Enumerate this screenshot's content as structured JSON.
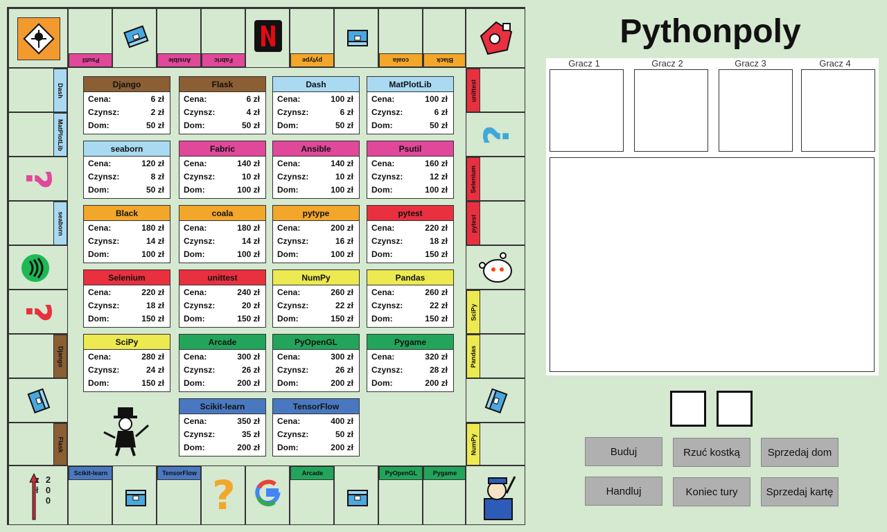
{
  "app": {
    "title": "Pythonpoly"
  },
  "players": [
    {
      "label": "Gracz 1"
    },
    {
      "label": "Gracz 2"
    },
    {
      "label": "Gracz 3"
    },
    {
      "label": "Gracz 4"
    }
  ],
  "buttons": {
    "build": "Buduj",
    "roll": "Rzuć kostką",
    "sell_house": "Sprzedaj dom",
    "trade": "Handluj",
    "end_turn": "Koniec tury",
    "sell_card": "Sprzedaj kartę"
  },
  "start": {
    "amount": "200 zł"
  },
  "board": {
    "top": [
      "Psutil",
      "Ansible",
      "Fabric",
      "pytype",
      "coala",
      "Black"
    ],
    "right": [
      "unittest",
      "Selenium",
      "pytest",
      "SciPy",
      "Pandas",
      "NumPy"
    ],
    "bottom": [
      "Scikit-learn",
      "TensorFlow",
      "Arcade",
      "PyOpenGL",
      "Pygame"
    ],
    "left": [
      "Dash",
      "MatPlotLib",
      "seaborn",
      "Django",
      "Flask"
    ]
  },
  "colors": {
    "brown": "#8b5e34",
    "lightblue": "#a9daf2",
    "pink": "#e0489a",
    "orange": "#f2a72a",
    "red": "#e8303f",
    "yellow": "#ecea50",
    "green": "#22a55a",
    "blue": "#4a78c0"
  },
  "labels": {
    "price": "Cena:",
    "rent": "Czynsz:",
    "house": "Dom:"
  },
  "cards": [
    {
      "name": "Django",
      "color": "#8b5e34",
      "price": "6 zł",
      "rent": "2 zł",
      "house": "50 zł"
    },
    {
      "name": "Flask",
      "color": "#8b5e34",
      "price": "6 zł",
      "rent": "4 zł",
      "house": "50 zł"
    },
    {
      "name": "Dash",
      "color": "#a9daf2",
      "price": "100 zł",
      "rent": "6 zł",
      "house": "50 zł"
    },
    {
      "name": "MatPlotLib",
      "color": "#a9daf2",
      "price": "100 zł",
      "rent": "6 zł",
      "house": "50 zł"
    },
    {
      "name": "seaborn",
      "color": "#a9daf2",
      "price": "120 zł",
      "rent": "8 zł",
      "house": "50 zł"
    },
    {
      "name": "Fabric",
      "color": "#e0489a",
      "price": "140 zł",
      "rent": "10 zł",
      "house": "100 zł"
    },
    {
      "name": "Ansible",
      "color": "#e0489a",
      "price": "140 zł",
      "rent": "10 zł",
      "house": "100 zł"
    },
    {
      "name": "Psutil",
      "color": "#e0489a",
      "price": "160 zł",
      "rent": "12 zł",
      "house": "100 zł"
    },
    {
      "name": "Black",
      "color": "#f2a72a",
      "price": "180 zł",
      "rent": "14 zł",
      "house": "100 zł"
    },
    {
      "name": "coala",
      "color": "#f2a72a",
      "price": "180 zł",
      "rent": "14 zł",
      "house": "100 zł"
    },
    {
      "name": "pytype",
      "color": "#f2a72a",
      "price": "200 zł",
      "rent": "16 zł",
      "house": "100 zł"
    },
    {
      "name": "pytest",
      "color": "#e8303f",
      "price": "220 zł",
      "rent": "18 zł",
      "house": "150 zł"
    },
    {
      "name": "Selenium",
      "color": "#e8303f",
      "price": "220 zł",
      "rent": "18 zł",
      "house": "150 zł"
    },
    {
      "name": "unittest",
      "color": "#e8303f",
      "price": "240 zł",
      "rent": "20 zł",
      "house": "150 zł"
    },
    {
      "name": "NumPy",
      "color": "#ecea50",
      "price": "260 zł",
      "rent": "22 zł",
      "house": "150 zł"
    },
    {
      "name": "Pandas",
      "color": "#ecea50",
      "price": "260 zł",
      "rent": "22 zł",
      "house": "150 zł"
    },
    {
      "name": "SciPy",
      "color": "#ecea50",
      "price": "280 zł",
      "rent": "24 zł",
      "house": "150 zł"
    },
    {
      "name": "Arcade",
      "color": "#22a55a",
      "price": "300 zł",
      "rent": "26 zł",
      "house": "200 zł"
    },
    {
      "name": "PyOpenGL",
      "color": "#22a55a",
      "price": "300 zł",
      "rent": "26 zł",
      "house": "200 zł"
    },
    {
      "name": "Pygame",
      "color": "#22a55a",
      "price": "320 zł",
      "rent": "28 zł",
      "house": "200 zł"
    },
    {
      "name": "Scikit-learn",
      "color": "#4a78c0",
      "price": "350 zł",
      "rent": "35 zł",
      "house": "200 zł"
    },
    {
      "name": "TensorFlow",
      "color": "#4a78c0",
      "price": "400 zł",
      "rent": "50 zł",
      "house": "200 zł"
    }
  ]
}
